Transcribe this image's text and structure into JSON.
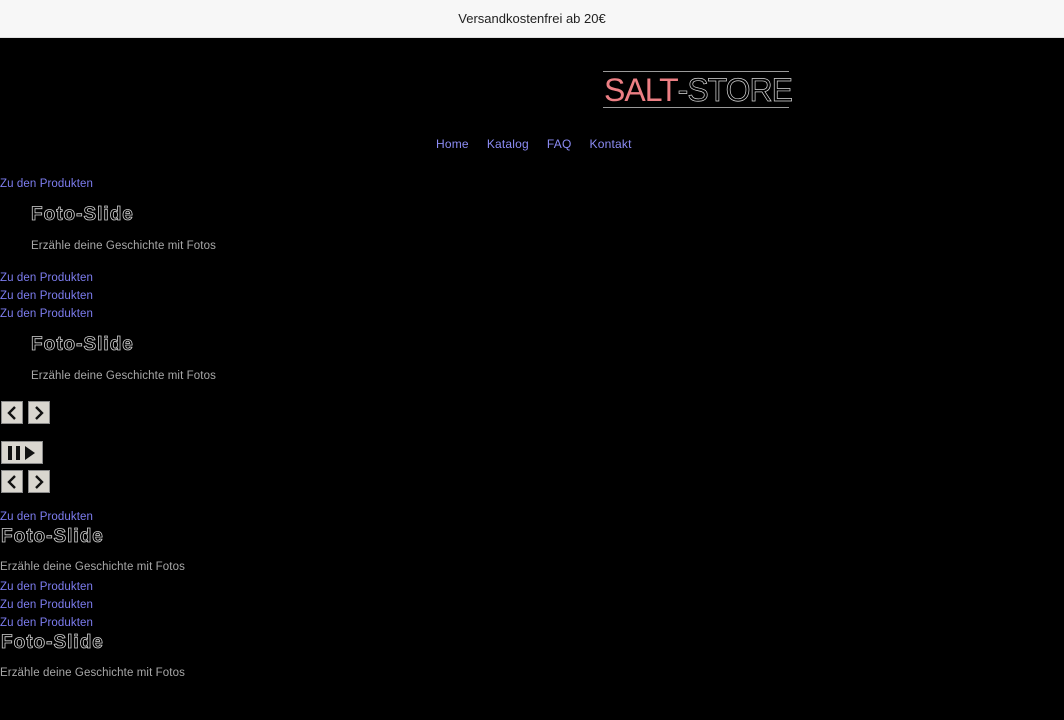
{
  "announcement": {
    "text": "Versandkostenfrei ab 20€"
  },
  "logo": {
    "part1": "SALT",
    "part2": "-STORE",
    "accent_color": "#ec7f84"
  },
  "nav": {
    "items": [
      {
        "label": "Home"
      },
      {
        "label": "Katalog"
      },
      {
        "label": "FAQ"
      },
      {
        "label": "Kontakt"
      }
    ]
  },
  "slideshow_1": {
    "link_top": "Zu den Produkten",
    "slide_1": {
      "title": "Foto-Slide",
      "description": "Erzähle deine Geschichte mit Fotos"
    },
    "links_middle": [
      "Zu den Produkten",
      "Zu den Produkten",
      "Zu den Produkten"
    ],
    "slide_2": {
      "title": "Foto-Slide",
      "description": "Erzähle deine Geschichte mit Fotos"
    },
    "controls": {
      "prev_icon": "chevron-left-icon",
      "next_icon": "chevron-right-icon"
    }
  },
  "slideshow_2": {
    "controls": {
      "pause_play_icon": "pause-play-icon",
      "prev_icon": "chevron-left-icon",
      "next_icon": "chevron-right-icon"
    },
    "link_top": "Zu den Produkten",
    "slide_1": {
      "title": "Foto-Slide",
      "description": "Erzähle deine Geschichte mit Fotos"
    },
    "links_middle": [
      "Zu den Produkten",
      "Zu den Produkten",
      "Zu den Produkten"
    ],
    "slide_2": {
      "title": "Foto-Slide",
      "description": "Erzähle deine Geschichte mit Fotos"
    }
  },
  "colors": {
    "link": "#7d7df0",
    "background": "#000000",
    "announcement_bg": "#f7f7f7"
  }
}
